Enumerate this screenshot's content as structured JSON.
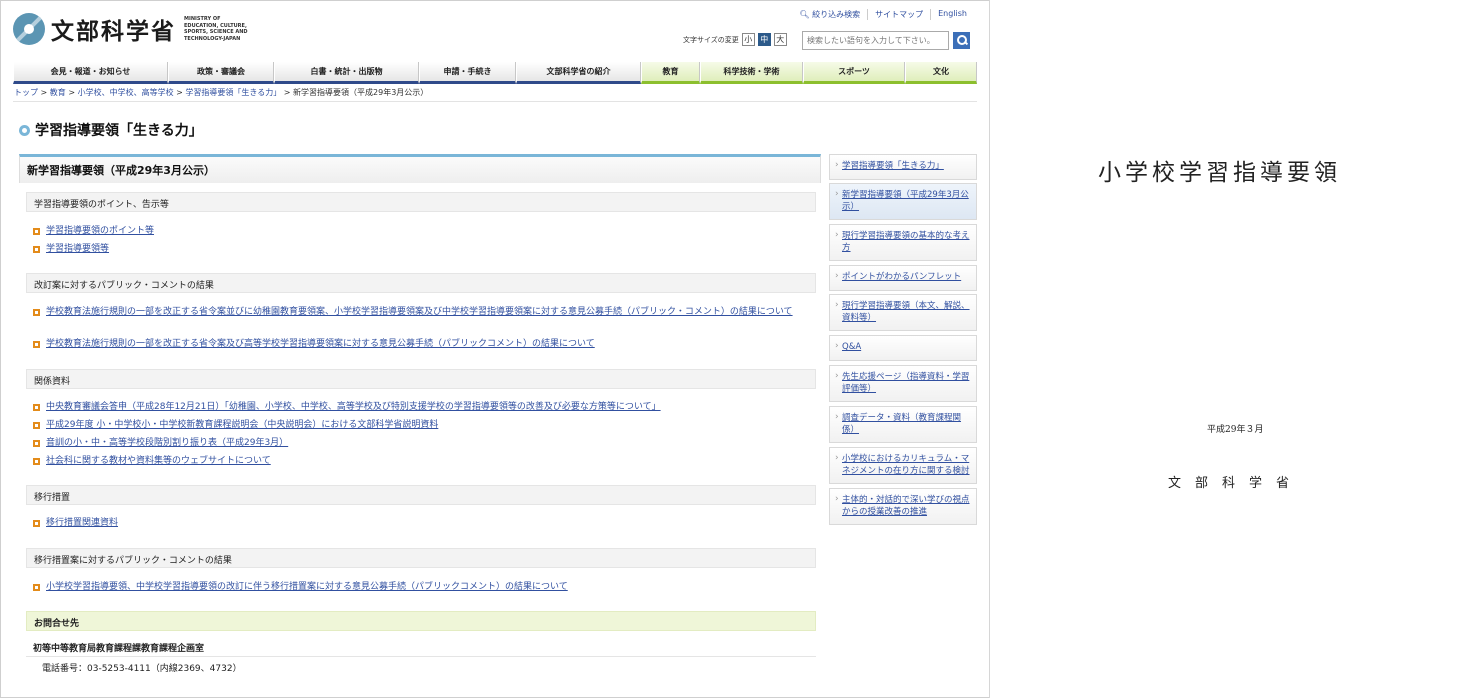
{
  "header": {
    "logo_text": "文部科学省",
    "logo_en": "MINISTRY OF EDUCATION, CULTURE, SPORTS, SCIENCE AND TECHNOLOGY-JAPAN",
    "util_links": [
      "絞り込み検索",
      "サイトマップ",
      "English"
    ],
    "font_size_label": "文字サイズの変更",
    "font_sizes": [
      "小",
      "中",
      "大"
    ],
    "search_placeholder": "検索したい語句を入力して下さい。"
  },
  "nav": [
    "会見・報道・お知らせ",
    "政策・審議会",
    "白書・統計・出版物",
    "申請・手続き",
    "文部科学省の紹介",
    "教育",
    "科学技術・学術",
    "スポーツ",
    "文化"
  ],
  "breadcrumb": [
    "トップ",
    "教育",
    "小学校、中学校、高等学校",
    "学習指導要領「生きる力」",
    "新学習指導要領（平成29年3月公示）"
  ],
  "page_title": "学習指導要領「生きる力」",
  "main": {
    "section_title": "新学習指導要領（平成29年3月公示）",
    "subsections": [
      {
        "title": "学習指導要領のポイント、告示等",
        "links": [
          "学習指導要領のポイント等",
          "学習指導要領等"
        ]
      },
      {
        "title": "改訂案に対するパブリック・コメントの結果",
        "links": [
          "学校教育法施行規則の一部を改正する省令案並びに幼稚園教育要領案、小学校学習指導要領案及び中学校学習指導要領案に対する意見公募手続（パブリック・コメント）の結果について",
          "学校教育法施行規則の一部を改正する省令案及び高等学校学習指導要領案に対する意見公募手続（パブリックコメント）の結果について"
        ]
      },
      {
        "title": "関係資料",
        "links": [
          "中央教育審議会答申（平成28年12月21日）「幼稚園、小学校、中学校、高等学校及び特別支援学校の学習指導要領等の改善及び必要な方策等について」",
          "平成29年度 小・中学校小・中学校新教育課程説明会（中央説明会）における文部科学省説明資料",
          "音訓の小・中・高等学校段階別割り振り表（平成29年3月）",
          "社会科に関する教材や資料集等のウェブサイトについて"
        ]
      },
      {
        "title": "移行措置",
        "links": [
          "移行措置関連資料"
        ]
      },
      {
        "title": "移行措置案に対するパブリック・コメントの結果",
        "links": [
          "小学校学習指導要領、中学校学習指導要領の改訂に伴う移行措置案に対する意見公募手続（パブリックコメント）の結果について"
        ]
      }
    ],
    "contact": {
      "title": "お問合せ先",
      "dept": "初等中等教育局教育課程課教育課程企画室",
      "tel": "電話番号：03-5253-4111（内線2369、4732）"
    }
  },
  "side": [
    "学習指導要領「生きる力」",
    "新学習指導要領（平成29年3月公示）",
    "現行学習指導要領の基本的な考え方",
    "ポイントがわかるパンフレット",
    "現行学習指導要領（本文、解説、資料等）",
    "Q&A",
    "先生応援ページ（指導資料・学習評価等）",
    "調査データ・資料（教育課程関係）",
    "小学校におけるカリキュラム・マネジメントの在り方に関する検討",
    "主体的・対話的で深い学びの視点からの授業改善の推進"
  ],
  "doc": {
    "title": "小学校学習指導要領",
    "date": "平成29年３月",
    "ministry": "文部科学省"
  },
  "colors": {
    "nav_border_blue": "#2f4a8a",
    "nav_border_green": "#8cbf2e",
    "accent": "#7ab6d8",
    "bullet": "#e38b1a",
    "link": "#3150a0"
  }
}
